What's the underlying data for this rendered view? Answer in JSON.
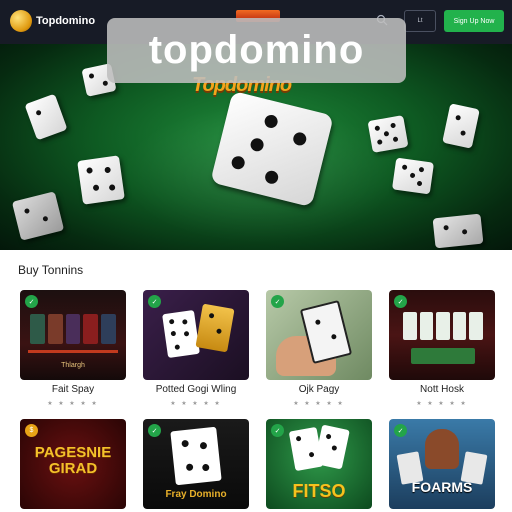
{
  "header": {
    "logo_text": "Topdomino",
    "login_label": "Lt",
    "signup_label": "Sign Up Now"
  },
  "hero": {
    "brand": "Topdomino"
  },
  "overlay": {
    "title": "topdomino"
  },
  "section": {
    "title": "Buy Tonnins"
  },
  "cards": [
    {
      "name": "Fait Spay",
      "stars": "★ ★ ★ ★ ★",
      "image_caption": "Thlargh"
    },
    {
      "name": "Potted Gogi Wling",
      "stars": "★ ★ ★ ★ ★",
      "image_caption": ""
    },
    {
      "name": "Ojk Pagy",
      "stars": "★ ★ ★ ★ ★",
      "image_caption": ""
    },
    {
      "name": "Nott Hosk",
      "stars": "★ ★ ★ ★ ★",
      "image_caption": ""
    },
    {
      "name": "",
      "stars": "",
      "image_caption": "PAGESNIE GIRAD"
    },
    {
      "name": "",
      "stars": "",
      "image_caption": "Fray Domino"
    },
    {
      "name": "",
      "stars": "",
      "image_caption": "FITSO"
    },
    {
      "name": "",
      "stars": "",
      "image_caption": "FOARMS"
    }
  ],
  "colors": {
    "header_bg": "#171b26",
    "signup": "#22b24c",
    "felt": "#0e5a22",
    "badge": "#23a449"
  }
}
